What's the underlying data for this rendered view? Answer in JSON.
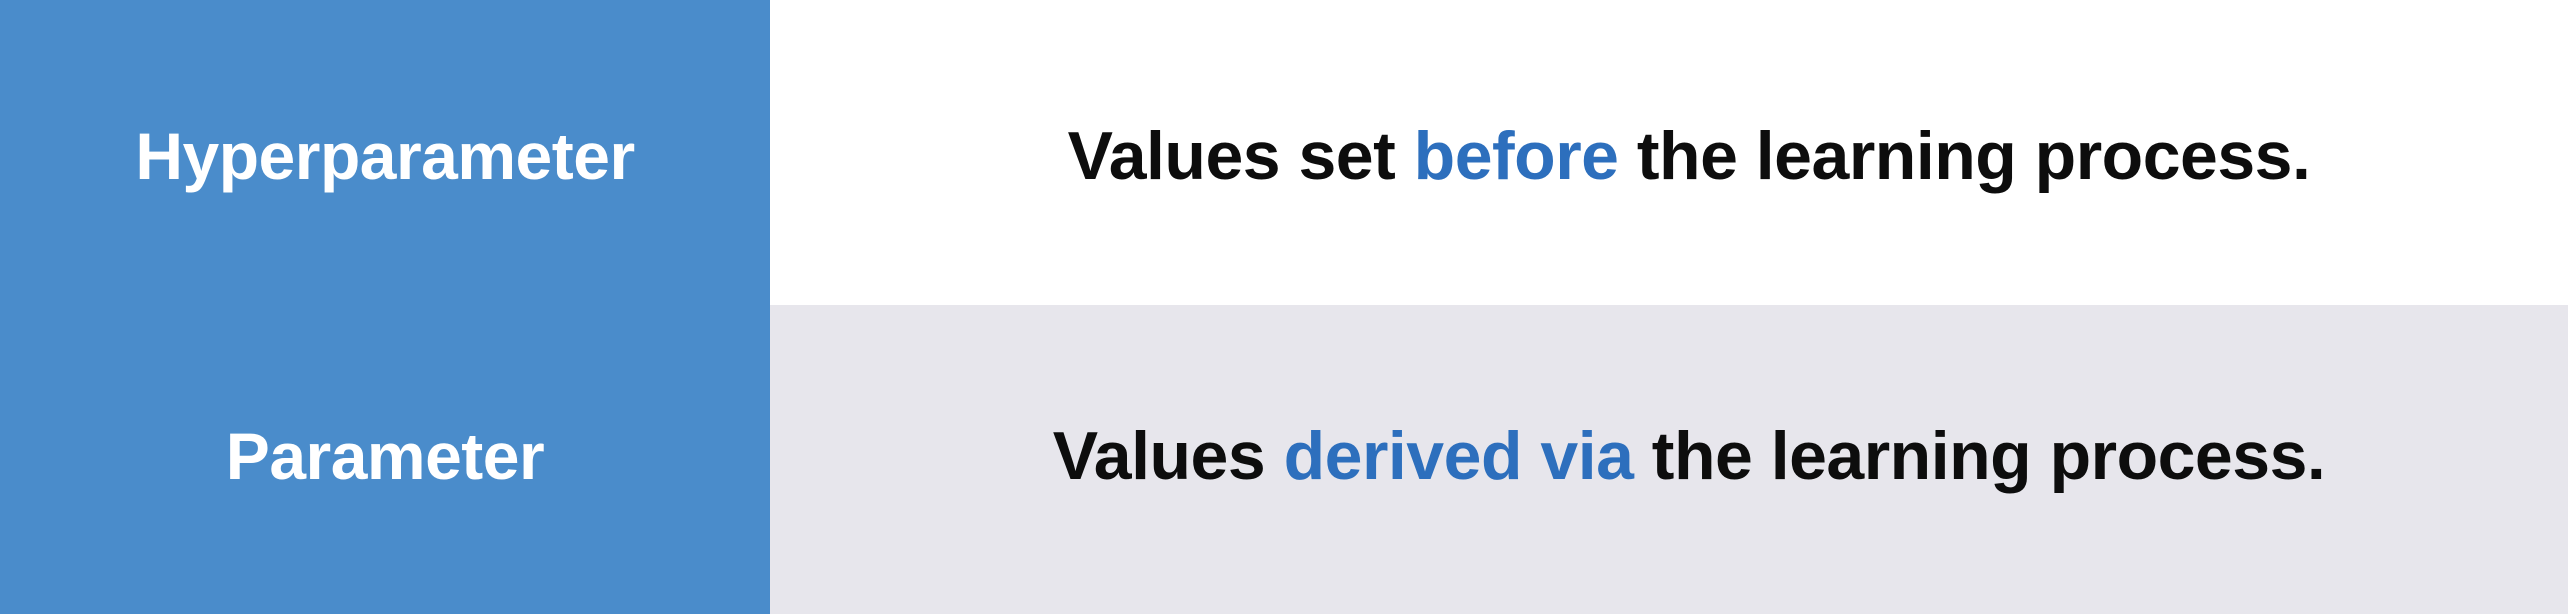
{
  "colors": {
    "term_background": "#4a8ccb",
    "term_text": "#ffffff",
    "definition_text": "#0d0d0d",
    "highlight_text": "#2d6fbd",
    "row1_background": "#ffffff",
    "row2_background": "#e7e6ec"
  },
  "rows": [
    {
      "term": "Hyperparameter",
      "definition_before": "Values set ",
      "definition_highlight": "before",
      "definition_after": " the learning process."
    },
    {
      "term": "Parameter",
      "definition_before": "Values ",
      "definition_highlight": "derived via",
      "definition_after": " the learning process."
    }
  ]
}
